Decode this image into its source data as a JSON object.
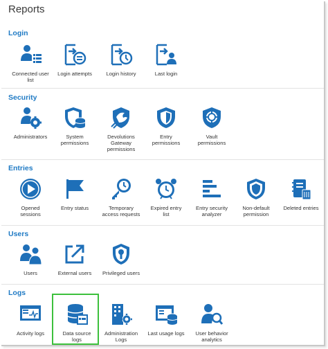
{
  "title": "Reports",
  "colors": {
    "accent": "#1f7ac4",
    "icon": "#1e6fb8",
    "selected_border": "#3cc03c"
  },
  "sections": {
    "login": {
      "title": "Login",
      "items": [
        {
          "label": "Connected user\nlist",
          "icon": "user-list-icon"
        },
        {
          "label": "Login attempts",
          "icon": "login-attempts-icon"
        },
        {
          "label": "Login history",
          "icon": "login-history-icon"
        },
        {
          "label": "Last login",
          "icon": "last-login-icon"
        }
      ]
    },
    "security": {
      "title": "Security",
      "items": [
        {
          "label": "Administrators",
          "icon": "admin-gear-icon"
        },
        {
          "label": "System\npermissions",
          "icon": "shield-database-icon"
        },
        {
          "label": "Devolutions\nGateway\npermissions",
          "icon": "gateway-icon"
        },
        {
          "label": "Entry\npermissions",
          "icon": "shield-icon"
        },
        {
          "label": "Vault\npermissions",
          "icon": "vault-icon"
        }
      ]
    },
    "entries": {
      "title": "Entries",
      "items": [
        {
          "label": "Opened\nsessions",
          "icon": "play-icon"
        },
        {
          "label": "Entry status",
          "icon": "flag-icon"
        },
        {
          "label": "Temporary\naccess requests",
          "icon": "temporary-key-icon"
        },
        {
          "label": "Expired entry\nlist",
          "icon": "alarm-clock-icon"
        },
        {
          "label": "Entry security\nanalyzer",
          "icon": "bars-icon"
        },
        {
          "label": "Non-default\npermission",
          "icon": "shield-outline-icon"
        },
        {
          "label": "Deleted entries",
          "icon": "deleted-notebook-icon"
        }
      ]
    },
    "users": {
      "title": "Users",
      "items": [
        {
          "label": "Users",
          "icon": "users-icon"
        },
        {
          "label": "External users",
          "icon": "external-link-icon"
        },
        {
          "label": "Privileged users",
          "icon": "privileged-shield-icon"
        }
      ]
    },
    "logs": {
      "title": "Logs",
      "items": [
        {
          "label": "Activity logs",
          "icon": "activity-monitor-icon"
        },
        {
          "label": "Data source\nlogs",
          "icon": "data-source-icon"
        },
        {
          "label": "Administration\nLogs",
          "icon": "building-gear-icon"
        },
        {
          "label": "Last usage logs",
          "icon": "window-database-icon"
        },
        {
          "label": "User behavior\nanalytics",
          "icon": "user-search-icon"
        }
      ]
    }
  }
}
